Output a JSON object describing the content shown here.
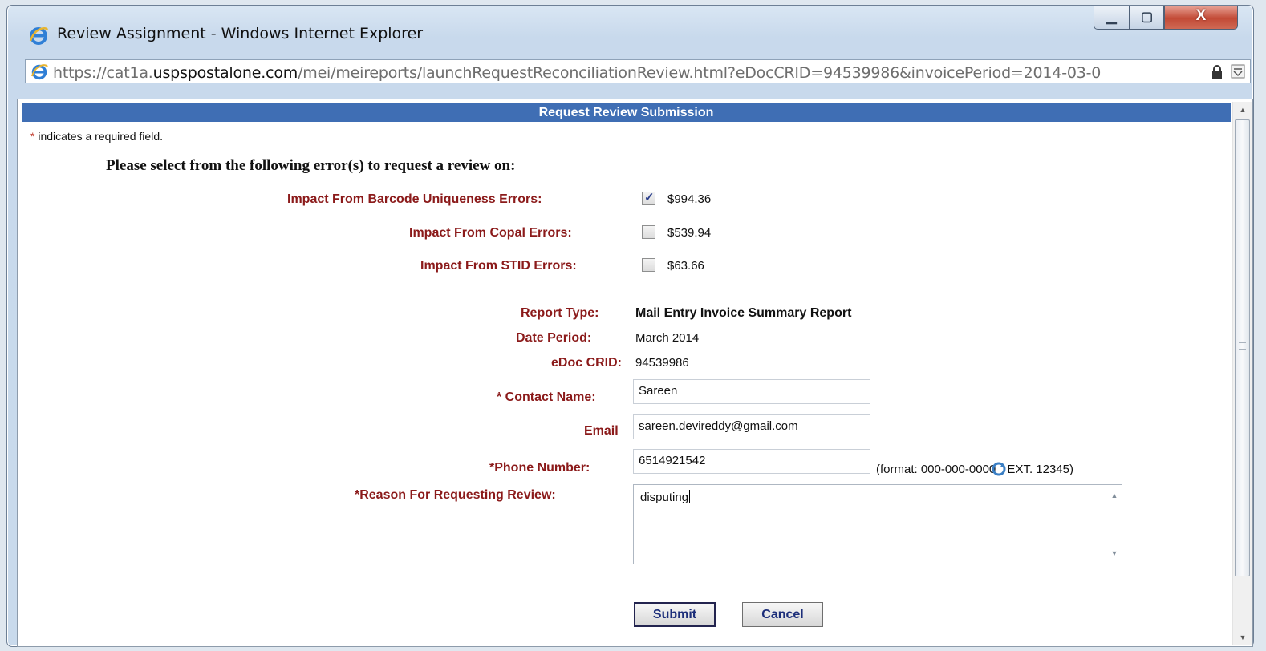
{
  "window": {
    "title": "Review Assignment - Windows Internet Explorer",
    "controls": {
      "minimize": "▁",
      "maximize": "▢",
      "close": "X"
    }
  },
  "address": {
    "prefix": "https://cat1a.",
    "host": "uspspostalone.com",
    "path": "/mei/meireports/launchRequestReconciliationReview.html?eDocCRID=94539986&invoicePeriod=2014-03-0"
  },
  "form": {
    "header": "Request Review Submission",
    "required_star": "*",
    "required_note": " indicates a required field.",
    "instruction": "Please select from the following error(s) to request a review on:",
    "errors": [
      {
        "label": "Impact From Barcode Uniqueness Errors:",
        "amount": "$994.36",
        "checked": true
      },
      {
        "label": "Impact From Copal Errors:",
        "amount": "$539.94",
        "checked": false
      },
      {
        "label": "Impact From STID Errors:",
        "amount": "$63.66",
        "checked": false
      }
    ],
    "report_type": {
      "label": "Report Type:",
      "value": "Mail Entry Invoice Summary Report"
    },
    "date_period": {
      "label": "Date Period:",
      "value": "March 2014"
    },
    "edoc_crid": {
      "label": "eDoc CRID:",
      "value": "94539986"
    },
    "contact_name": {
      "label": "* Contact Name:",
      "value": "Sareen"
    },
    "email": {
      "label": "Email",
      "value": "sareen.devireddy@gmail.com"
    },
    "phone": {
      "label": "*Phone Number:",
      "value": "6514921542",
      "format_prefix": "(format: 000-000-0000",
      "format_suffix": " EXT. 12345)"
    },
    "reason": {
      "label": "*Reason For Requesting Review:",
      "value": "disputing"
    },
    "buttons": {
      "submit": "Submit",
      "cancel": "Cancel"
    }
  },
  "colors": {
    "header_bar": "#3f6eb4",
    "label_red": "#8b1a1a",
    "button_text": "#1c2e7a"
  }
}
